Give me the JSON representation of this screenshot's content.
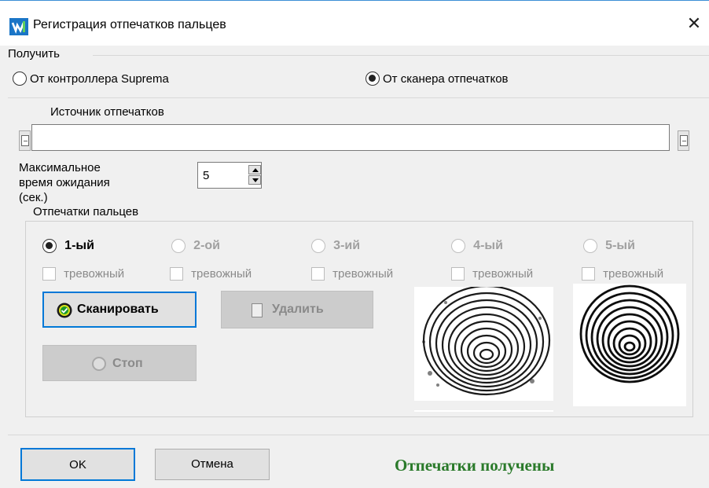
{
  "window": {
    "title": "Регистрация отпечатков пальцев",
    "close_glyph": "✕"
  },
  "receive": {
    "group_label": "Получить",
    "option_controller": "От контроллера Suprema",
    "option_scanner": "От сканера отпечатков",
    "selected": "scanner"
  },
  "source": {
    "label": "Источник отпечатков",
    "value": ""
  },
  "timeout": {
    "label_line1": "Максимальное",
    "label_line2": "время ожидания",
    "label_line3": "(сек.)",
    "value": "5"
  },
  "fingerprints": {
    "group_label": "Отпечатки пальцев",
    "slots": [
      {
        "label": "1-ый",
        "selected": true,
        "enabled": true,
        "alarm_label": "тревожный"
      },
      {
        "label": "2-ой",
        "selected": false,
        "enabled": false,
        "alarm_label": "тревожный"
      },
      {
        "label": "3-ий",
        "selected": false,
        "enabled": false,
        "alarm_label": "тревожный"
      },
      {
        "label": "4-ый",
        "selected": false,
        "enabled": false,
        "alarm_label": "тревожный"
      },
      {
        "label": "5-ый",
        "selected": false,
        "enabled": false,
        "alarm_label": "тревожный"
      }
    ],
    "scan_button": "Сканировать",
    "delete_button": "Удалить",
    "stop_button": "Стоп"
  },
  "footer": {
    "ok_button": "OK",
    "cancel_button": "Отмена",
    "status": "Отпечатки получены",
    "status_color": "#2a7a2a"
  },
  "icons": {
    "app": "fingerprint-app-icon",
    "scan": "scan-green-icon",
    "delete": "document-icon",
    "stop": "stop-circle-icon"
  }
}
